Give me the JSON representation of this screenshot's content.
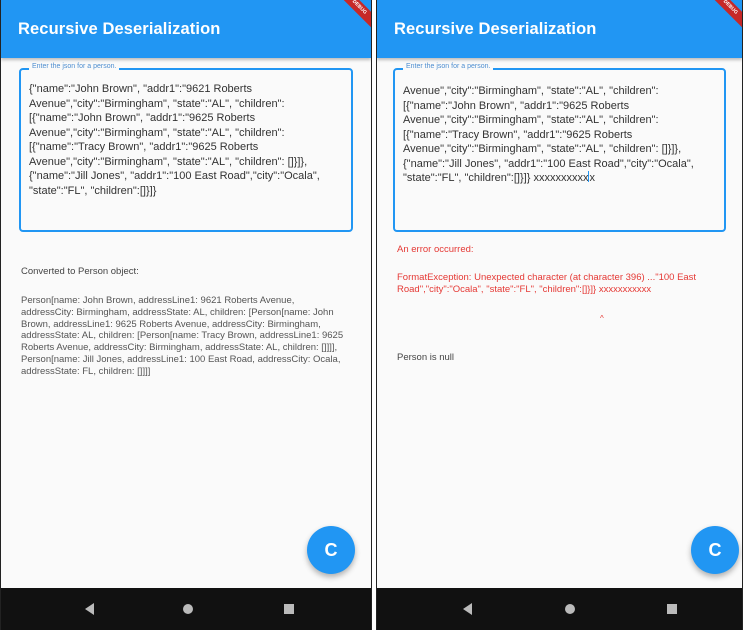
{
  "left_screen": {
    "app_title": "Recursive Deserialization",
    "debug_banner": "DEBUG",
    "input_label": "Enter the json for a person.",
    "input_value": "{\"name\":\"John Brown\", \"addr1\":\"9621 Roberts Avenue\",\"city\":\"Birmingham\", \"state\":\"AL\", \"children\": [{\"name\":\"John Brown\", \"addr1\":\"9625 Roberts Avenue\",\"city\":\"Birmingham\", \"state\":\"AL\", \"children\": [{\"name\":\"Tracy Brown\", \"addr1\":\"9625 Roberts Avenue\",\"city\":\"Birmingham\", \"state\":\"AL\", \"children\": []}]},{\"name\":\"Jill Jones\", \"addr1\":\"100 East Road\",\"city\":\"Ocala\", \"state\":\"FL\", \"children\":[]}]}",
    "result_label": "Converted to Person object:",
    "result_text": "Person[name: John Brown, addressLine1: 9621 Roberts Avenue, addressCity: Birmingham, addressState: AL, children: [Person[name: John Brown, addressLine1: 9625 Roberts Avenue, addressCity: Birmingham, addressState: AL, children: [Person[name: Tracy Brown, addressLine1: 9625 Roberts Avenue, addressCity: Birmingham, addressState: AL, children: []]]], Person[name: Jill Jones, addressLine1: 100 East Road, addressCity: Ocala, addressState: FL, children: []]]]",
    "fab_icon": "refresh-icon",
    "fab_glyph": "C"
  },
  "right_screen": {
    "app_title": "Recursive Deserialization",
    "debug_banner": "DEBUG",
    "input_label": "Enter the json for a person.",
    "input_value": "Avenue\",\"city\":\"Birmingham\", \"state\":\"AL\", \"children\": [{\"name\":\"John Brown\", \"addr1\":\"9625 Roberts Avenue\",\"city\":\"Birmingham\", \"state\":\"AL\", \"children\": [{\"name\":\"Tracy Brown\", \"addr1\":\"9625 Roberts Avenue\",\"city\":\"Birmingham\", \"state\":\"AL\", \"children\": []}]},{\"name\":\"Jill Jones\", \"addr1\":\"100 East Road\",\"city\":\"Ocala\", \"state\":\"FL\", \"children\":[]}]}",
    "input_trailing_before_caret": "xxxxxxxxxx",
    "input_trailing_after_caret": "x",
    "error_heading": "An error occurred:",
    "error_text": "FormatException: Unexpected character (at character 396) ...\"100 East Road\",\"city\":\"Ocala\", \"state\":\"FL\", \"children\":[]}]} xxxxxxxxxxx",
    "error_pointer": "^",
    "person_status": "Person is null",
    "fab_icon": "refresh-icon",
    "fab_glyph": "C"
  },
  "nav_bar": {
    "back_icon": "back-triangle-icon",
    "home_icon": "home-circle-icon",
    "recents_icon": "recents-square-icon"
  },
  "colors": {
    "primary": "#2196f3",
    "error": "#e53935",
    "nav_bar": "#111111"
  }
}
